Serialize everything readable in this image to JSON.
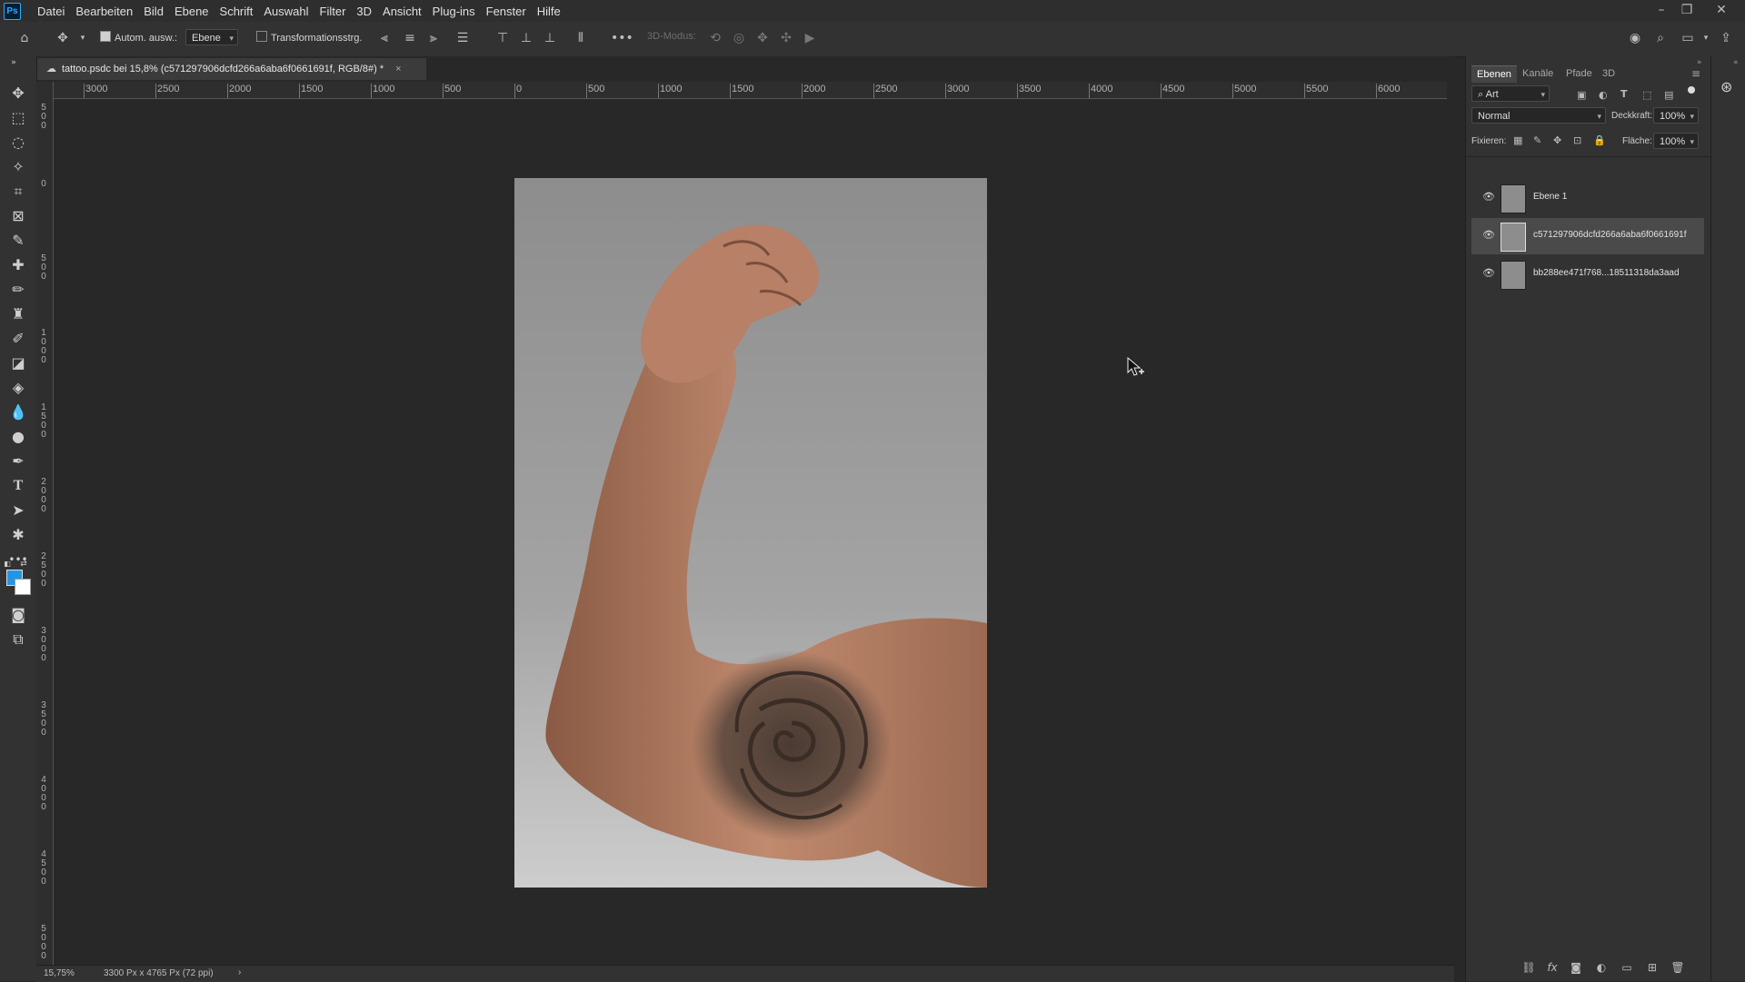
{
  "app": {
    "logo": "Ps"
  },
  "menu": [
    "Datei",
    "Bearbeiten",
    "Bild",
    "Ebene",
    "Schrift",
    "Auswahl",
    "Filter",
    "3D",
    "Ansicht",
    "Plug-ins",
    "Fenster",
    "Hilfe"
  ],
  "options": {
    "auto_select_label": "Autom. ausw.:",
    "auto_select_target": "Ebene",
    "transform_controls_label": "Transformationsstrg.",
    "mode_3d_label": "3D-Modus:"
  },
  "document": {
    "tab_title": "tattoo.psdc bei 15,8% (c571297906dcfd266a6aba6f0661691f, RGB/8#) *",
    "close_glyph": "×"
  },
  "ruler": {
    "h_labels": [
      "3000",
      "2500",
      "2000",
      "1500",
      "1000",
      "500",
      "0",
      "500",
      "1000",
      "1500",
      "2000",
      "2500",
      "3000",
      "3500",
      "4000",
      "4500",
      "5000",
      "5500",
      "6000"
    ],
    "v_labels": [
      "500",
      "0",
      "500",
      "1000",
      "1500",
      "2000",
      "2500",
      "3000",
      "3500",
      "4000",
      "4500",
      "5000"
    ]
  },
  "status": {
    "zoom": "15,75%",
    "doc_info": "3300 Px x 4765 Px (72 ppi)",
    "arrow": "›"
  },
  "panel": {
    "tabs": [
      "Ebenen",
      "Kanäle",
      "Pfade",
      "3D"
    ],
    "filter_kind": "Art",
    "blend_mode": "Normal",
    "opacity_label": "Deckkraft:",
    "opacity_value": "100%",
    "lock_label": "Fixieren:",
    "fill_label": "Fläche:",
    "fill_value": "100%",
    "layers": [
      {
        "name": "Ebene 1",
        "selected": false
      },
      {
        "name": "c571297906dcfd266a6aba6f0661691f",
        "selected": true
      },
      {
        "name": "bb288ee471f768...18511318da3aad",
        "selected": false
      }
    ]
  },
  "colors": {
    "foreground": "#2196e8",
    "background": "#ffffff",
    "accent": "#31a8ff"
  }
}
